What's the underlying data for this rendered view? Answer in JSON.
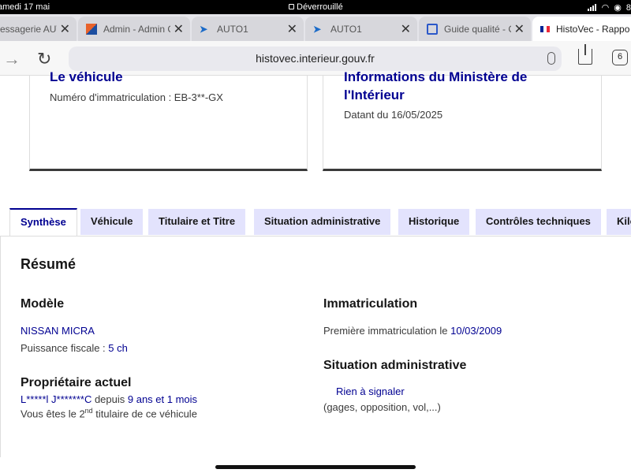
{
  "status_bar": {
    "date": "amedi 17 mai",
    "lock_text": "Déverrouillé",
    "battery_text": "8"
  },
  "browser": {
    "tabs": [
      {
        "title": "essagerie AUT",
        "favicon": "mail-icon"
      },
      {
        "title": "Admin - Admin C",
        "favicon": "admin-icon"
      },
      {
        "title": "AUTO1",
        "favicon": "auto1-icon"
      },
      {
        "title": "AUTO1",
        "favicon": "auto1-icon"
      },
      {
        "title": "Guide qualité - C",
        "favicon": "guide-icon"
      },
      {
        "title": "HistoVec - Rappo",
        "favicon": "french-flag-icon"
      }
    ],
    "url": "histovec.interieur.gouv.fr",
    "tab_count": "6"
  },
  "cards": {
    "vehicle": {
      "title": "Le véhicule",
      "plate": "Numéro d'immatriculation : EB-3**-GX"
    },
    "ministry": {
      "title_line1": "Informations du Ministère de",
      "title_line2": "l'Intérieur",
      "date": "Datant du 16/05/2025"
    }
  },
  "page_tabs": [
    "Synthèse",
    "Véhicule",
    "Titulaire et Titre",
    "Situation administrative",
    "Historique",
    "Contrôles techniques",
    "Kilo"
  ],
  "summary": {
    "title": "Résumé",
    "model": {
      "heading": "Modèle",
      "name": "NISSAN MICRA",
      "power_label": "Puissance fiscale : ",
      "power_value": "5 ch"
    },
    "owner": {
      "heading": "Propriétaire actuel",
      "name": "L*****l J*******C",
      "since_label": " depuis ",
      "since_value": "9 ans et 1 mois",
      "rank_prefix": "Vous êtes le 2",
      "rank_sup": "nd",
      "rank_suffix": " titulaire de ce véhicule"
    },
    "registration": {
      "heading": "Immatriculation",
      "first_label": "Première immatriculation le ",
      "first_date": "10/03/2009"
    },
    "admin": {
      "heading": "Situation administrative",
      "status": "Rien à signaler",
      "details": "(gages, opposition, vol,...)"
    }
  }
}
